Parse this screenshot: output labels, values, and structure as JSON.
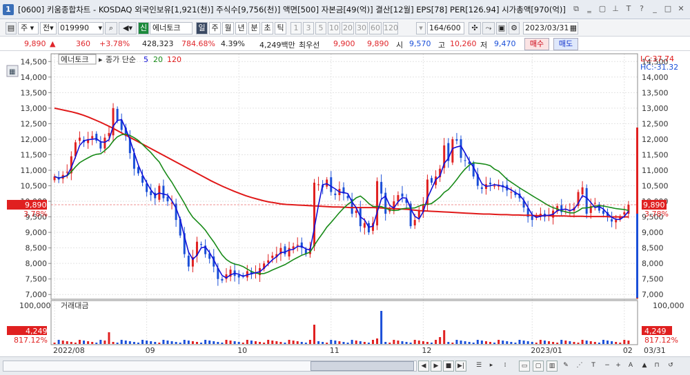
{
  "window": {
    "title": "[0600] 키움종합차트 - KOSDAQ 외국인보유[1,921(천)] 주식수[9,756(천)] 액면[500] 자본금[49(억)] 결산[12월] EPS[78] PER[126.94] 시가총액[970(억)]"
  },
  "toolbar": {
    "period_main": "주",
    "market": "전",
    "code": "019990",
    "stock_tag": "신",
    "stock_name": "에너토크",
    "periods": [
      "일",
      "주",
      "월",
      "년",
      "분",
      "초",
      "틱"
    ],
    "minutes": [
      "1",
      "3",
      "5",
      "10",
      "20",
      "30",
      "60",
      "120"
    ],
    "count": "164",
    "count_total": "/600",
    "date": "2023/03/31"
  },
  "quote": {
    "price": "9,890",
    "change": "360",
    "change_pct": "+3.78%",
    "volume": "428,323",
    "volume_pct": "784.68%",
    "turnover_rate": "4.39%",
    "trade_value": "4,249백만",
    "best_label": "최우선",
    "ask": "9,900",
    "bid": "9,890",
    "open_label": "시",
    "open": "9,570",
    "high_label": "고",
    "high": "10,260",
    "low_label": "저",
    "low": "9,470",
    "buy_label": "매수",
    "sell_label": "매도"
  },
  "chart_data": {
    "type": "candlestick",
    "legend": {
      "stock": "에너토크",
      "ma_label": "종가 단순",
      "ma_periods": [
        "5",
        "20",
        "120"
      ]
    },
    "ma_colors": {
      "ma5": "#1010d8",
      "ma20": "#178a17",
      "ma120": "#e01818"
    },
    "y_ticks": [
      "14,500",
      "14,000",
      "13,500",
      "13,000",
      "12,500",
      "12,000",
      "11,500",
      "11,000",
      "10,500",
      "10,000",
      "9,890",
      "9,500",
      "9,000",
      "8,500",
      "8,000",
      "7,500",
      "7,000"
    ],
    "ylim": [
      6850,
      14750
    ],
    "x_labels": [
      "2022/08",
      "09",
      "10",
      "11",
      "12",
      "2023/01",
      "02",
      "03"
    ],
    "x_label_end": "03/31",
    "hc_lc": {
      "lc": "LC:37.74",
      "hc": "HC:-31.32"
    },
    "last_price": "9,890",
    "last_pct": "3.78%",
    "close": [
      10800,
      10700,
      10850,
      10950,
      11450,
      11900,
      12050,
      11900,
      12000,
      12100,
      11950,
      11700,
      12050,
      12200,
      13000,
      12600,
      12300,
      12100,
      11550,
      11050,
      10900,
      10600,
      10300,
      10200,
      10100,
      10500,
      10100,
      10000,
      9950,
      9400,
      8900,
      8300,
      7900,
      8200,
      8700,
      8600,
      8300,
      8150,
      7900,
      7500,
      7450,
      7650,
      7800,
      7600,
      7550,
      7600,
      7750,
      7650,
      7700,
      7850,
      8000,
      8100,
      8250,
      8300,
      8500,
      8300,
      8500,
      8550,
      8600,
      8500,
      8300,
      8500,
      10600,
      10550,
      10450,
      10700,
      10300,
      10200,
      10400,
      10250,
      10100,
      9600,
      9700,
      9200,
      9300,
      9000,
      9300,
      10650,
      10250,
      9600,
      9750,
      10000,
      10200,
      10150,
      9950,
      9200,
      9400,
      9700,
      9900,
      10700,
      10600,
      10800,
      11050,
      11800,
      11300,
      12000,
      11950,
      11400,
      11300,
      11200,
      10800,
      10500,
      10400,
      10550,
      10550,
      10500,
      10500,
      10450,
      10350,
      10300,
      10200,
      10100,
      9800,
      9500,
      9400,
      9550,
      9600,
      9500,
      9550,
      9700,
      9850,
      9650,
      9750,
      9700,
      9800,
      10300,
      10450,
      9600,
      9850,
      9950,
      9700,
      9600,
      9500,
      9350,
      9400,
      9500,
      9650,
      9890
    ],
    "ma120": [
      13000,
      12960,
      12920,
      12880,
      12830,
      12770,
      12700,
      12620,
      12540,
      12450,
      12360,
      12260,
      12160,
      12060,
      11960,
      11860,
      11760,
      11660,
      11560,
      11460,
      11360,
      11260,
      11160,
      11060,
      10960,
      10860,
      10760,
      10660,
      10570,
      10480,
      10400,
      10320,
      10250,
      10180,
      10120,
      10070,
      10020,
      9980,
      9950,
      9920,
      9900,
      9890,
      9880,
      9870,
      9860,
      9850,
      9840,
      9830,
      9820,
      9820,
      9810,
      9800,
      9800,
      9800,
      9800,
      9800,
      9790,
      9780,
      9770,
      9760,
      9750,
      9740,
      9720,
      9700,
      9690,
      9680,
      9670,
      9660,
      9650,
      9640,
      9630,
      9620,
      9610,
      9600,
      9590,
      9590,
      9580,
      9570,
      9570,
      9560,
      9560,
      9550,
      9550,
      9540,
      9540,
      9540,
      9530,
      9530,
      9530,
      9520,
      9520,
      9520,
      9510,
      9510,
      9510,
      9510,
      9500,
      9500,
      9500,
      9500
    ]
  }
}
